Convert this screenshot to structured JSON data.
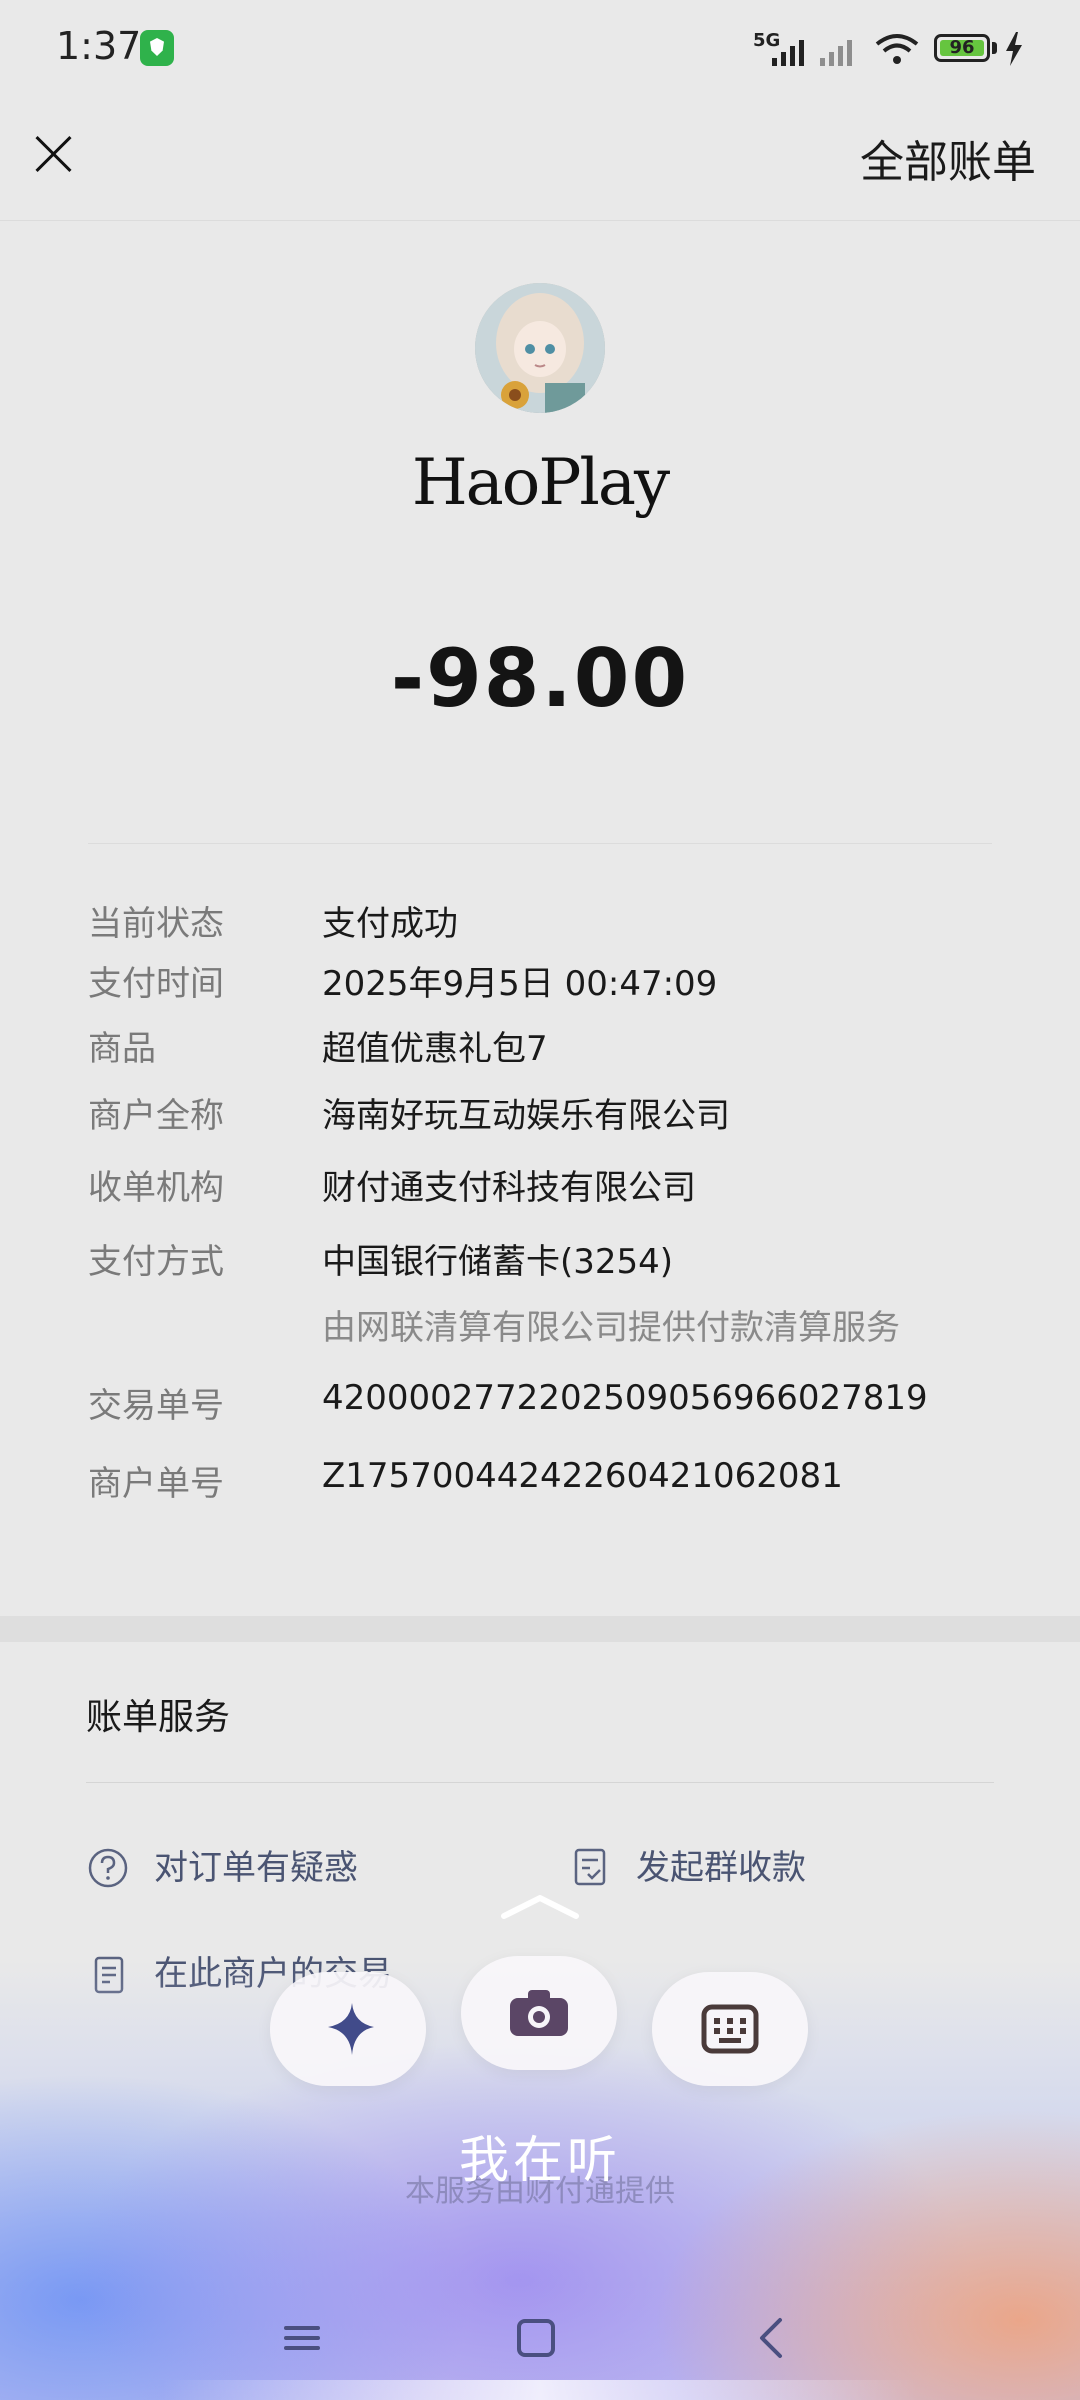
{
  "status_bar": {
    "time": "1:37",
    "network": "5G",
    "battery": "96"
  },
  "nav": {
    "right_link": "全部账单"
  },
  "merchant": {
    "name": "HaoPlay",
    "amount": "-98.00"
  },
  "details": [
    {
      "label": "当前状态",
      "value": "支付成功"
    },
    {
      "label": "支付时间",
      "value": "2025年9月5日 00:47:09"
    },
    {
      "label": "商品",
      "value": "超值优惠礼包7"
    },
    {
      "label": "商户全称",
      "value": "海南好玩互动娱乐有限公司"
    },
    {
      "label": "收单机构",
      "value": "财付通支付科技有限公司"
    },
    {
      "label": "支付方式",
      "value": "中国银行储蓄卡(3254)"
    },
    {
      "label": "交易单号",
      "value": "4200002772202509056966027819"
    },
    {
      "label": "商户单号",
      "value": "Z17570044242260421062081"
    }
  ],
  "payment_note": "由网联清算有限公司提供付款清算服务",
  "bill_services": {
    "title": "账单服务",
    "items": [
      "对订单有疑惑",
      "发起群收款",
      "在此商户的交易"
    ]
  },
  "footer_note": "本服务由财付通提供",
  "assistant": {
    "status": "我在听"
  },
  "icons": {
    "sparkle": "sparkle-icon",
    "camera": "camera-icon",
    "keyboard": "keyboard-icon",
    "menu": "menu-icon",
    "home": "home-icon",
    "back": "back-icon"
  }
}
